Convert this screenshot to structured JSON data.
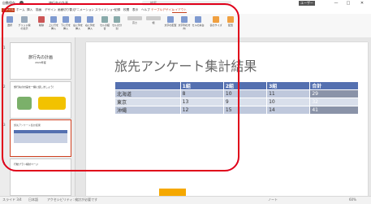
{
  "titlebar": {
    "autosave_label": "自動保存",
    "filename": "旅行先の計画",
    "search_placeholder": "検索",
    "user_badge": "ユーザー",
    "min": "—",
    "max": "□",
    "close": "✕"
  },
  "tabs": [
    "ファイル",
    "ホーム",
    "挿入",
    "描画",
    "デザイン",
    "画面切り替え",
    "アニメーション",
    "スライドショー",
    "記録",
    "校閲",
    "表示",
    "ヘルプ",
    "テーブルデザイン",
    "レイアウト"
  ],
  "active_tab_index": 13,
  "ribbon": {
    "buttons": [
      "選択",
      "グリッド線の表示",
      "削除",
      "上に行を挿入",
      "下に行を挿入",
      "左に列を挿入",
      "右に列を挿入",
      "セルの結合",
      "セルの分割",
      "高さ",
      "幅",
      "文字の配置",
      "文字列の方向",
      "セルの余白",
      "表のサイズ",
      "配置"
    ],
    "groups": [
      "表",
      "行と列",
      "結合",
      "セルのサイズ",
      "配置",
      "表のサイズ",
      "配置"
    ]
  },
  "thumbnails": [
    {
      "num": "1",
      "title": "旅行先の計画",
      "subtitle": "2024年度"
    },
    {
      "num": "2",
      "title": "旅行先の計画を一緒に話しましょう！"
    },
    {
      "num": "3",
      "title": "旅先アンケート集計結果"
    },
    {
      "num": "4",
      "title": "行動プラン検討ページ"
    }
  ],
  "slide": {
    "title": "旅先アンケート集計結果",
    "table": {
      "headers": [
        "",
        "1組",
        "2組",
        "3組",
        "合計"
      ],
      "rows": [
        [
          "北海道",
          "8",
          "10",
          "11",
          "29"
        ],
        [
          "東京",
          "13",
          "9",
          "10",
          "32"
        ],
        [
          "沖縄",
          "12",
          "15",
          "14",
          "41"
        ]
      ]
    }
  },
  "statusbar": {
    "slide_info": "スライド 3/4",
    "notes": "ノート",
    "language": "日本語",
    "accessibility": "アクセシビリティ: 検討が必要です",
    "zoom": "60%"
  },
  "colors": {
    "accent": "#d04020",
    "table_header": "#5470b0",
    "annotation": "#e0001a"
  }
}
